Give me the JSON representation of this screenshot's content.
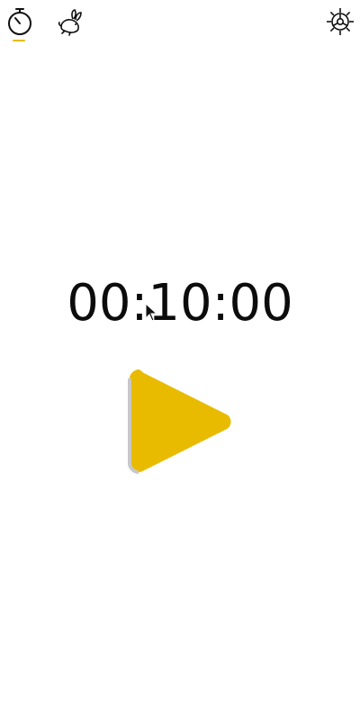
{
  "header": {
    "tabs": [
      {
        "icon": "timer-icon",
        "active": true
      },
      {
        "icon": "rabbit-icon",
        "active": false
      }
    ],
    "settings_icon": "gear-icon"
  },
  "timer": {
    "display": "00:10:00"
  },
  "controls": {
    "play_icon": "play-icon"
  },
  "colors": {
    "accent": "#E8BB00",
    "text": "#0c0c0c",
    "background": "#ffffff"
  }
}
